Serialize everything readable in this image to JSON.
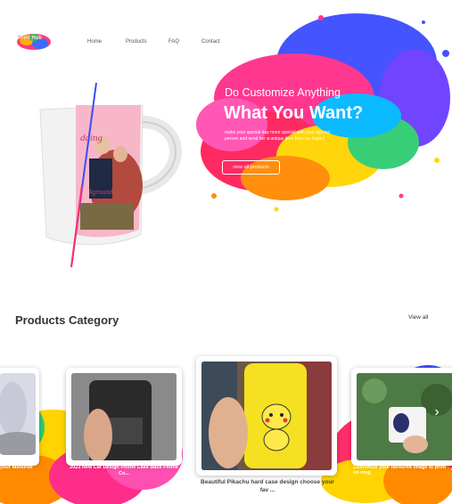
{
  "brand": {
    "logo_text": "Print Hub"
  },
  "nav": {
    "items": [
      "Home",
      "Products",
      "FAQ",
      "Contact"
    ]
  },
  "hero": {
    "subtitle": "Do Customize Anything",
    "title": "What You Want?",
    "description": "make your special day more special with your special person and send her a unique item from us. hope:)",
    "button_label": "view all products",
    "mug_text": [
      "dding",
      "kground"
    ]
  },
  "products": {
    "heading": "Products Category",
    "view_all": "View all",
    "cards": [
      {
        "caption": "your favourite"
      },
      {
        "caption": "2023 New Car Design Phone Case Back Phone Co..."
      },
      {
        "caption": "Beautiful Pikachu hard case design choose your fav ..."
      },
      {
        "caption": "Customize your favourite image to print on mug"
      }
    ]
  },
  "colors": {
    "accent": "#ff2d8a",
    "splash_blue": "#3a4bff",
    "splash_yellow": "#ffd400",
    "case_yellow": "#f5e021"
  }
}
